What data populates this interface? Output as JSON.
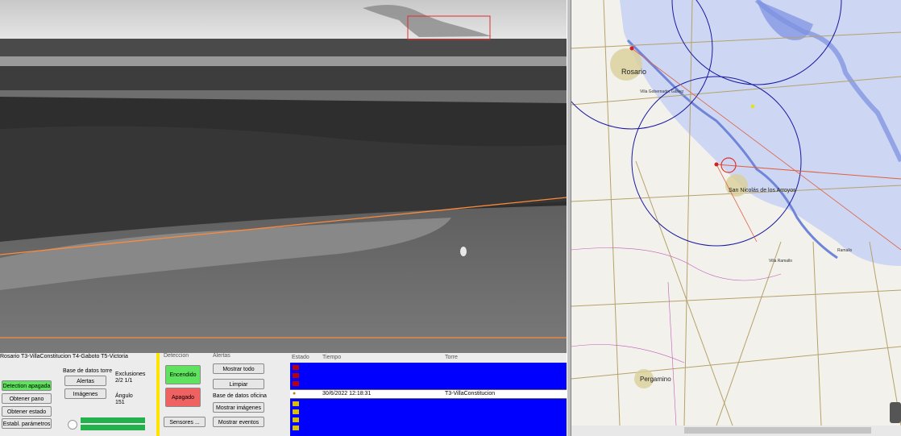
{
  "panels": {
    "tower_tabs": "Rosario T3-VillaConstitucion T4-Gaboto T5-Victoria",
    "deteccion_header": "Deteccion",
    "alertas_header": "Alertas",
    "events_headers": {
      "estado": "Estado",
      "tiempo": "Tiempo",
      "torre": "Torre"
    }
  },
  "left_controls": {
    "detection_btn": "Detection apagada",
    "obtener_pano": "Obtener pano",
    "obtener_estado": "Obtener estado",
    "establ_parametros": "Establ. parámetros"
  },
  "db_torre": {
    "title": "Base de datos torre",
    "alertas": "Alertas",
    "imagenes": "Imágenes"
  },
  "exclusiones": {
    "label": "Exclusiones",
    "value": "2/2  1/1"
  },
  "angulo": {
    "label": "Ángulo",
    "value": "151"
  },
  "deteccion": {
    "encendido": "Encendido",
    "apagado": "Apagado",
    "sensores": "Sensores ..."
  },
  "alertas": {
    "mostrar_todo": "Mostrar todo",
    "limpiar": "Limpiar",
    "db_oficina": "Base de datos oficina",
    "mostrar_imagenes": "Mostrar imágenes",
    "mostrar_eventos": "Mostrar eventos"
  },
  "events": {
    "selected": {
      "tiempo": "30/6/2022 12:18:31",
      "torre": "T3-VillaConstitucion"
    }
  },
  "map_labels": {
    "rosario": "Rosario",
    "san_nicolas": "San Nicolás de los Arroyos",
    "pergamino": "Pergamino",
    "villa_ramallo": "Villa Ramallo",
    "villa_gobernador": "Villa Gobernador Gálvez",
    "ramallo": "Ramallo"
  },
  "colors": {
    "detection_on": "#5fe35f",
    "detection_off": "#f06262",
    "event_row": "#0000ff",
    "range_circle": "#1a1aa0",
    "bearing_line": "#e06040",
    "alert_box": "#e03030"
  }
}
